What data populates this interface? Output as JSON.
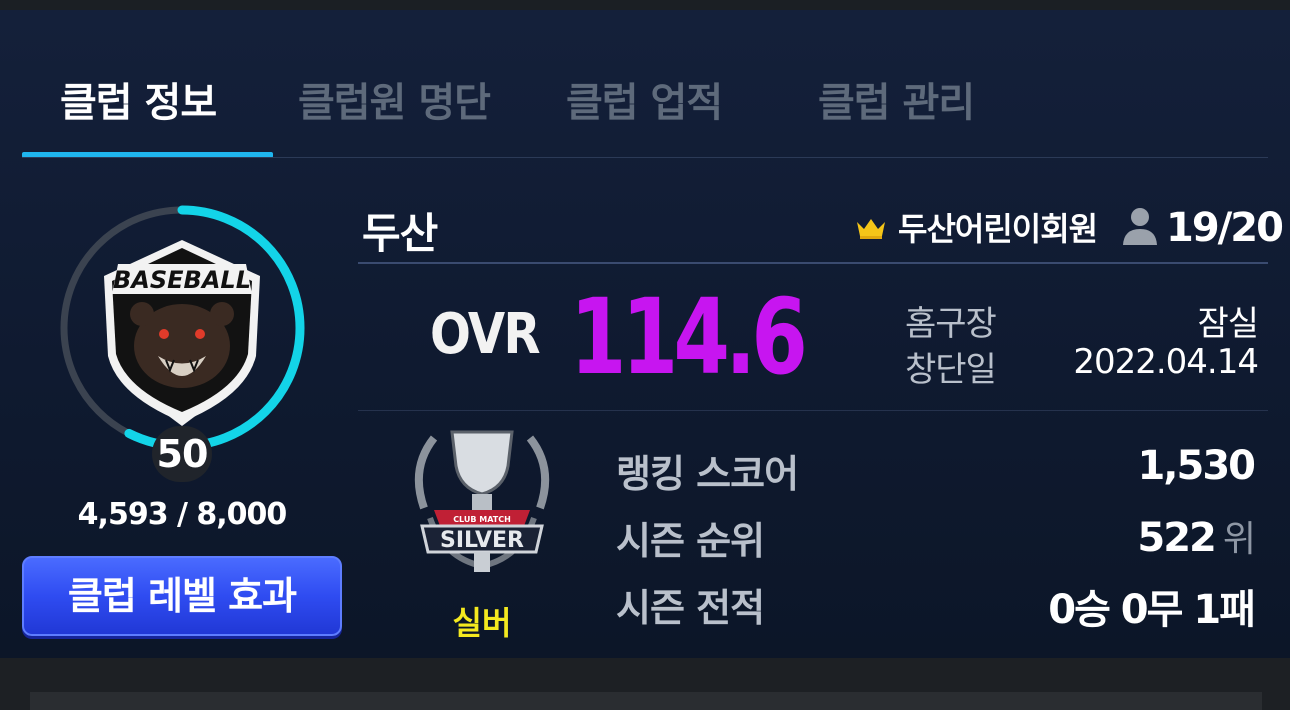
{
  "tabs": [
    {
      "label": "클럽 정보",
      "active": true
    },
    {
      "label": "클럽원 명단",
      "active": false
    },
    {
      "label": "클럽 업적",
      "active": false
    },
    {
      "label": "클럽 관리",
      "active": false
    }
  ],
  "club": {
    "name": "두산",
    "leader_name": "두산어린이회원",
    "members": "19/20",
    "level": "50",
    "exp_text": "4,593 / 8,000",
    "exp_progress": 0.574,
    "emblem_text": "BASEBALL",
    "level_effect_label": "클럽 레벨 효과"
  },
  "ovr": {
    "label": "OVR",
    "value": "114.6"
  },
  "details": {
    "home_label": "홈구장",
    "home_value": "잠실",
    "founded_label": "창단일",
    "founded_value": "2022.04.14"
  },
  "tier": {
    "name": "실버",
    "badge_text": "SILVER",
    "badge_subtext": "CLUB MATCH"
  },
  "stats": {
    "ranking_score_label": "랭킹 스코어",
    "ranking_score_value": "1,530",
    "season_rank_label": "시즌 순위",
    "season_rank_value": "522",
    "season_rank_unit": "위",
    "season_record_label": "시즌 전적",
    "season_record_value": "0승 0무 1패"
  },
  "colors": {
    "accent": "#1fb6ef",
    "ovr": "#c715f0",
    "tier": "#f4e91f",
    "button": "#2f4cf1"
  },
  "icons": [
    "crown-icon",
    "person-icon",
    "club-emblem",
    "silver-tier-emblem"
  ]
}
